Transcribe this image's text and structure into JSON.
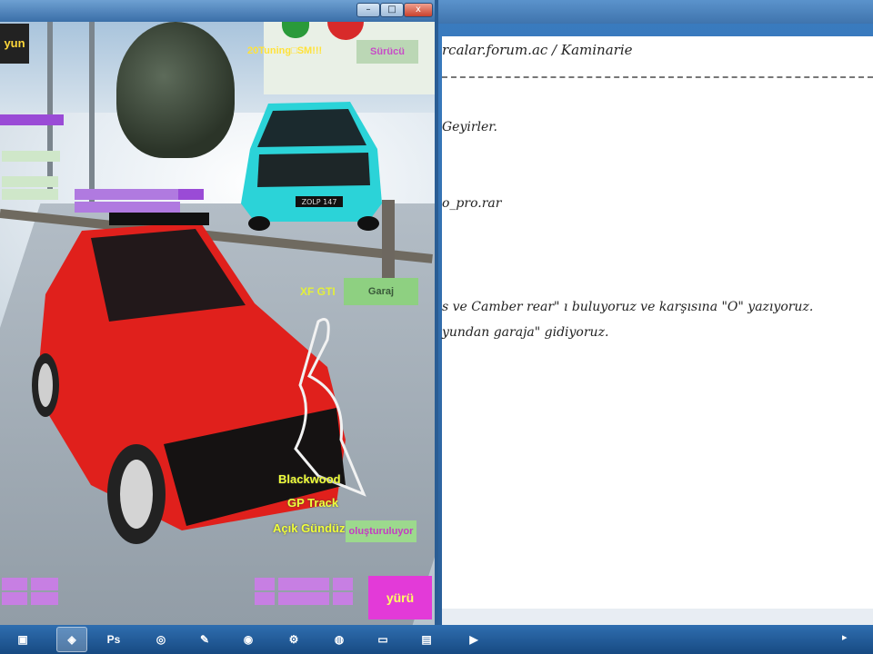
{
  "background_window": {
    "header_text": "rcalar.forum.ac / Kaminarie",
    "post_lines": [
      "Geyirler.",
      "o_pro.rar",
      "s ve Camber rear\" ı buluyoruz ve karşısına \"O\" yazıyoruz.",
      "yundan garaja\" gidiyoruz."
    ]
  },
  "game_window": {
    "controls": {
      "minimize": "–",
      "maximize": "□",
      "close": "x"
    },
    "hud": {
      "logo_text": "yun",
      "tuning_text": "20Tuning□SM!!!",
      "surucu_button": "Sürücü",
      "car_name": "XF GTI",
      "garaj_button": "Garaj",
      "track_lines": [
        "Blackwood",
        "GP Track",
        "Açık Gündüz"
      ],
      "olusturuluyor_button": "oluşturuluyor",
      "yuru_button": "yürü",
      "plate_text": "ZOLP 147"
    }
  },
  "taskbar": {
    "items": [
      {
        "name": "avatar-app-icon",
        "glyph": "▣"
      },
      {
        "name": "game-app-icon",
        "glyph": "◈"
      },
      {
        "name": "photoshop-icon",
        "glyph": "Ps"
      },
      {
        "name": "browser-icon",
        "glyph": "◎"
      },
      {
        "name": "paint-icon",
        "glyph": "✎"
      },
      {
        "name": "camera-icon",
        "glyph": "◉"
      },
      {
        "name": "network-icon",
        "glyph": "⚙"
      },
      {
        "name": "chrome-icon",
        "glyph": "◍"
      },
      {
        "name": "window-icon",
        "glyph": "▭"
      },
      {
        "name": "folder-icon",
        "glyph": "▤"
      },
      {
        "name": "media-icon",
        "glyph": "▶"
      }
    ],
    "tray_arrow": "▸"
  },
  "colors": {
    "hud_yellow": "#f0ff3a",
    "hud_magenta": "#e33ad8",
    "hud_green": "#8ed081",
    "car_red": "#e0201c",
    "car_cyan": "#2bd3d8"
  }
}
